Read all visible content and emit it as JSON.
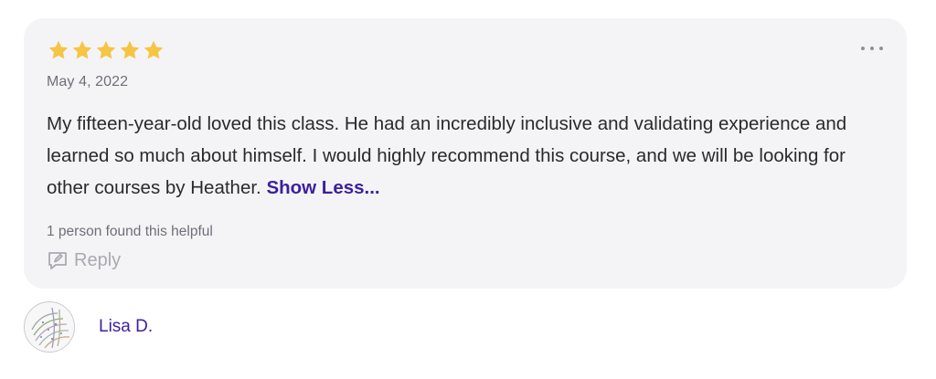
{
  "review": {
    "rating": 5,
    "rating_max": 5,
    "star_color": "#f5c543",
    "date": "May 4, 2022",
    "text": "My fifteen-year-old loved this class. He had an incredibly inclusive and validating experience and learned so much about himself. I would highly recommend this course, and we will be looking for other courses by Heather.",
    "show_less_label": "Show Less...",
    "helpful_text": "1 person found this helpful",
    "reply_label": "Reply",
    "more_icon": "more-horizontal-icon"
  },
  "author": {
    "name": "Lisa D."
  },
  "colors": {
    "link": "#3d1f9e",
    "card_bg": "#f4f4f7",
    "muted": "#6f6f78"
  }
}
